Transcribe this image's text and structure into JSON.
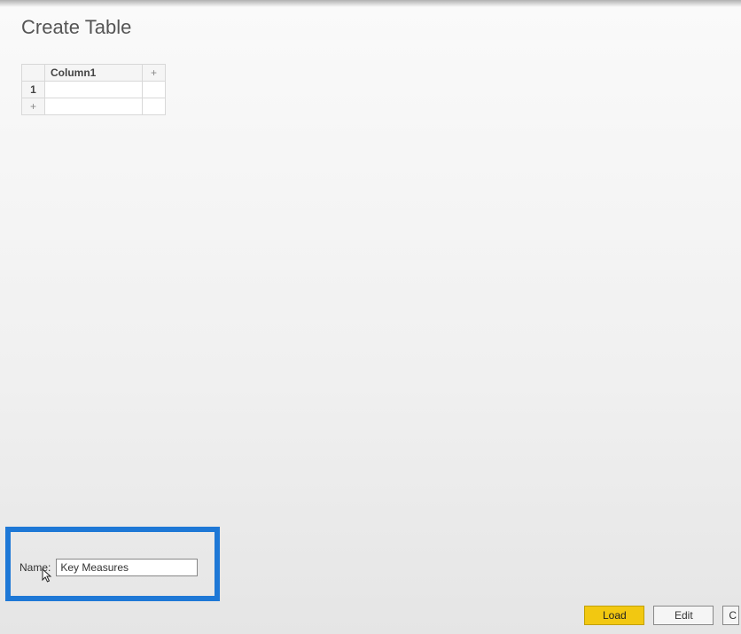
{
  "header": {
    "title": "Create Table"
  },
  "grid": {
    "column_header": "Column1",
    "add_column_symbol": "+",
    "row_index_1": "1",
    "add_row_symbol": "+",
    "cell_1_1": ""
  },
  "name_section": {
    "label": "Name:",
    "value": "Key Measures"
  },
  "buttons": {
    "load": "Load",
    "edit": "Edit",
    "cancel_partial": "C"
  }
}
